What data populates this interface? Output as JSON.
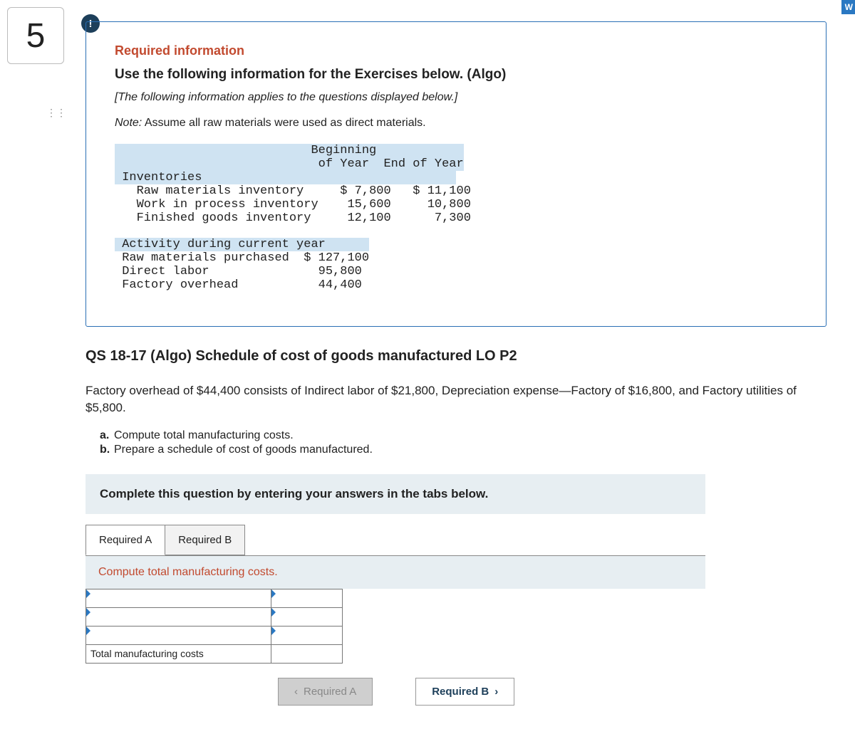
{
  "question_number": "5",
  "bang": "!",
  "info": {
    "required_label": "Required information",
    "use_info": "Use the following information for the Exercises below. (Algo)",
    "italic": "[The following information applies to the questions displayed below.]",
    "note_prefix": "Note:",
    "note_text": " Assume all raw materials were used as direct materials."
  },
  "inventory_table": {
    "col1": "Beginning\nof Year",
    "col2": "End of Year",
    "section": "Inventories",
    "rows": [
      {
        "label": "Raw materials inventory",
        "beg": "$ 7,800",
        "end": "$ 11,100"
      },
      {
        "label": "Work in process inventory",
        "beg": "15,600",
        "end": "10,800"
      },
      {
        "label": "Finished goods inventory",
        "beg": "12,100",
        "end": "7,300"
      }
    ]
  },
  "activity_table": {
    "section": "Activity during current year",
    "rows": [
      {
        "label": "Raw materials purchased",
        "val": "$ 127,100"
      },
      {
        "label": "Direct labor",
        "val": "95,800"
      },
      {
        "label": "Factory overhead",
        "val": "44,400"
      }
    ]
  },
  "qtitle": "QS 18-17 (Algo) Schedule of cost of goods manufactured LO P2",
  "overhead_text": "Factory overhead of $44,400 consists of Indirect labor of $21,800, Depreciation expense—Factory of $16,800, and Factory utilities of $5,800.",
  "tasks": {
    "a": "Compute total manufacturing costs.",
    "b": "Prepare a schedule of cost of goods manufactured."
  },
  "complete_prompt": "Complete this question by entering your answers in the tabs below.",
  "tabs": {
    "a": "Required A",
    "b": "Required B"
  },
  "subheader": "Compute total manufacturing costs.",
  "answer_rows": {
    "r4_label": "Total manufacturing costs"
  },
  "nav": {
    "prev": "Required A",
    "next": "Required B"
  },
  "corner": "W"
}
